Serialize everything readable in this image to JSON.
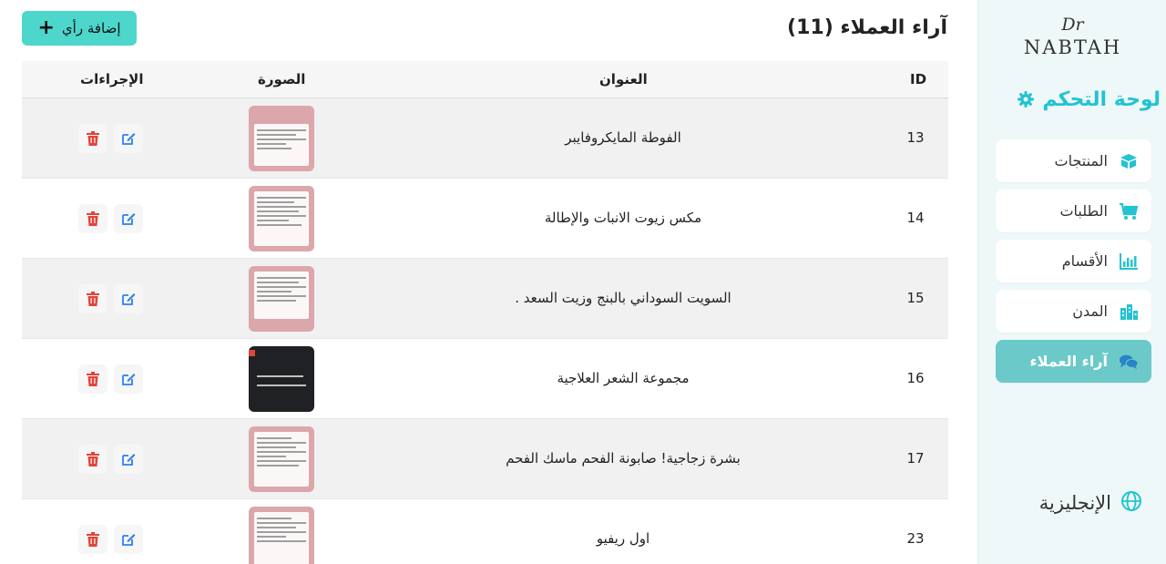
{
  "sidebar": {
    "logo_top": "Dr",
    "logo_name": "NABTAH",
    "dashboard_title": "لوحة التحكم",
    "items": [
      {
        "label": "المنتجات",
        "icon": "box-icon"
      },
      {
        "label": "الطلبات",
        "icon": "cart-icon"
      },
      {
        "label": "الأقسام",
        "icon": "chart-bar-icon"
      },
      {
        "label": "المدن",
        "icon": "city-icon"
      },
      {
        "label": "آراء العملاء",
        "icon": "comments-icon",
        "active": true
      }
    ],
    "language": "الإنجليزية"
  },
  "header": {
    "title": "آراء العملاء (11)",
    "add_button": "إضافة رأي"
  },
  "table": {
    "columns": [
      "ID",
      "العنوان",
      "الصورة",
      "الإجراءات"
    ],
    "rows": [
      {
        "id": "13",
        "title": "الفوطة المايكروفايبر"
      },
      {
        "id": "14",
        "title": "مكس زيوت الانبات والإطالة"
      },
      {
        "id": "15",
        "title": "السويت السوداني بالبنج وزيت السعد ."
      },
      {
        "id": "16",
        "title": "مجموعة الشعر العلاجية"
      },
      {
        "id": "17",
        "title": "بشرة زجاجية! صابونة الفحم ماسك الفحم"
      },
      {
        "id": "23",
        "title": "اول ريفيو"
      }
    ]
  },
  "colors": {
    "accent": "#22c3d2",
    "add_button_bg": "#4dd6cc",
    "active_nav_bg": "#6cc9c9",
    "edit_icon": "#2f80ed",
    "delete_icon": "#e0453a"
  }
}
